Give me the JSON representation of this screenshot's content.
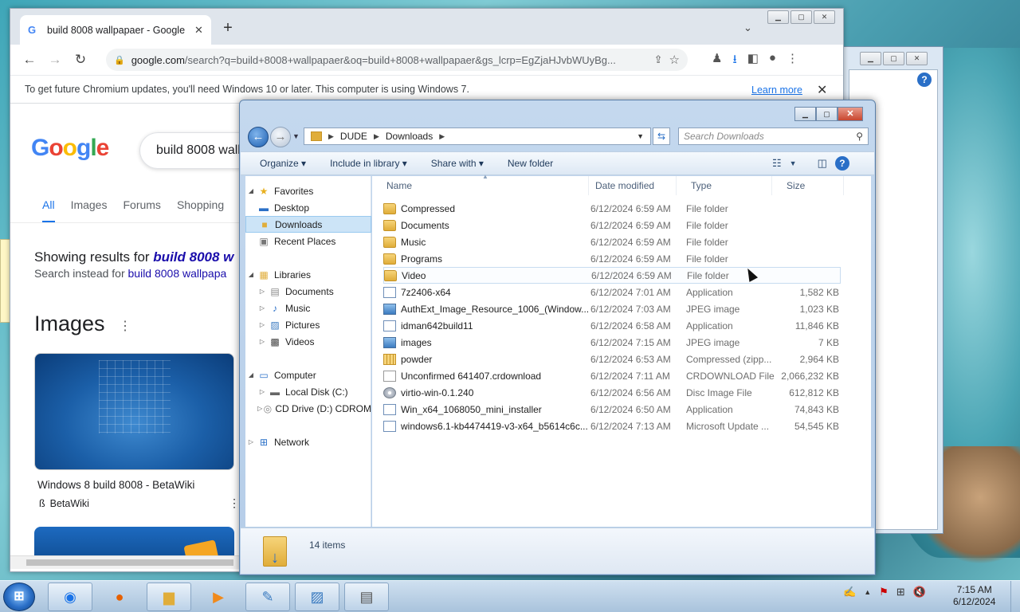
{
  "browser": {
    "tab_title": "build 8008 wallpapaer - Google S",
    "tab_close": "✕",
    "new_tab": "+",
    "url_main": "google.com",
    "url_rest": "/search?q=build+8008+wallpapaer&oq=build+8008+wallpapaer&gs_lcrp=EgZjaHJvbWUyBg...",
    "infobar_text": "To get future Chromium updates, you'll need Windows 10 or later. This computer is using Windows 7.",
    "infobar_link": "Learn more",
    "infobar_close": "✕"
  },
  "google": {
    "logo_letters": [
      "G",
      "o",
      "o",
      "g",
      "l",
      "e"
    ],
    "logo_colors": [
      "#4285f4",
      "#ea4335",
      "#fbbc05",
      "#4285f4",
      "#34a853",
      "#ea4335"
    ],
    "search_query": "build 8008 wall",
    "tabs": [
      "All",
      "Images",
      "Forums",
      "Shopping"
    ],
    "showing_prefix": "Showing results for ",
    "showing_link": "build 8008 w",
    "instead_prefix": "Search instead for ",
    "instead_link": "build 8008 wallpapa",
    "images_heading": "Images",
    "image_result": {
      "caption": "Windows 8 build 8008 - BetaWiki",
      "source": "BetaWiki"
    }
  },
  "explorer": {
    "breadcrumb": [
      "DUDE",
      "Downloads"
    ],
    "search_placeholder": "Search Downloads",
    "commands": [
      "Organize ▾",
      "Include in library ▾",
      "Share with ▾",
      "New folder"
    ],
    "nav": {
      "favorites": "Favorites",
      "desktop": "Desktop",
      "downloads": "Downloads",
      "recent": "Recent Places",
      "libraries": "Libraries",
      "documents": "Documents",
      "music": "Music",
      "pictures": "Pictures",
      "videos": "Videos",
      "computer": "Computer",
      "local_disk": "Local Disk (C:)",
      "cd_drive": "CD Drive (D:) CDROM",
      "network": "Network"
    },
    "columns": [
      "Name",
      "Date modified",
      "Type",
      "Size"
    ],
    "files": [
      {
        "name": "Compressed",
        "date": "6/12/2024 6:59 AM",
        "type": "File folder",
        "size": "",
        "icon": "folder"
      },
      {
        "name": "Documents",
        "date": "6/12/2024 6:59 AM",
        "type": "File folder",
        "size": "",
        "icon": "folder"
      },
      {
        "name": "Music",
        "date": "6/12/2024 6:59 AM",
        "type": "File folder",
        "size": "",
        "icon": "folder"
      },
      {
        "name": "Programs",
        "date": "6/12/2024 6:59 AM",
        "type": "File folder",
        "size": "",
        "icon": "folder"
      },
      {
        "name": "Video",
        "date": "6/12/2024 6:59 AM",
        "type": "File folder",
        "size": "",
        "icon": "folder"
      },
      {
        "name": "7z2406-x64",
        "date": "6/12/2024 7:01 AM",
        "type": "Application",
        "size": "1,582 KB",
        "icon": "app"
      },
      {
        "name": "AuthExt_Image_Resource_1006_(Window...",
        "date": "6/12/2024 7:03 AM",
        "type": "JPEG image",
        "size": "1,023 KB",
        "icon": "image"
      },
      {
        "name": "idman642build11",
        "date": "6/12/2024 6:58 AM",
        "type": "Application",
        "size": "11,846 KB",
        "icon": "app"
      },
      {
        "name": "images",
        "date": "6/12/2024 7:15 AM",
        "type": "JPEG image",
        "size": "7 KB",
        "icon": "image"
      },
      {
        "name": "powder",
        "date": "6/12/2024 6:53 AM",
        "type": "Compressed (zipp...",
        "size": "2,964 KB",
        "icon": "zip"
      },
      {
        "name": "Unconfirmed 641407.crdownload",
        "date": "6/12/2024 7:11 AM",
        "type": "CRDOWNLOAD File",
        "size": "2,066,232 KB",
        "icon": "doc"
      },
      {
        "name": "virtio-win-0.1.240",
        "date": "6/12/2024 6:56 AM",
        "type": "Disc Image File",
        "size": "612,812 KB",
        "icon": "disc"
      },
      {
        "name": "Win_x64_1068050_mini_installer",
        "date": "6/12/2024 6:50 AM",
        "type": "Application",
        "size": "74,843 KB",
        "icon": "app"
      },
      {
        "name": "windows6.1-kb4474419-v3-x64_b5614c6c...",
        "date": "6/12/2024 7:13 AM",
        "type": "Microsoft Update ...",
        "size": "54,545 KB",
        "icon": "app"
      }
    ],
    "items_count": "14 items"
  },
  "taskbar": {
    "time": "7:15 AM",
    "date": "6/12/2024"
  }
}
